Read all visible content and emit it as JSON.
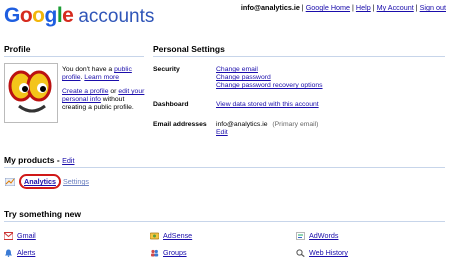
{
  "header": {
    "logo_letters": [
      "G",
      "o",
      "o",
      "g",
      "l",
      "e"
    ],
    "logo_colors": [
      "#1e5ee0",
      "#d62b1e",
      "#f2b60a",
      "#1e5ee0",
      "#1b9d33",
      "#d62b1e"
    ],
    "product_name": "accounts",
    "user_email": "info@analytics.ie",
    "links": [
      "Google Home",
      "Help",
      "My Account",
      "Sign out"
    ]
  },
  "profile": {
    "title": "Profile",
    "text1": "You don't have a ",
    "link_public_profile": "public profile",
    "text1b": ". ",
    "link_learn_more": "Learn more",
    "link_create_profile": "Create a profile",
    "text2": " or ",
    "link_edit_personal": "edit your personal info",
    "text3": " without creating a public profile."
  },
  "personal_settings": {
    "title": "Personal Settings",
    "security_label": "Security",
    "security_links": [
      "Change email",
      "Change password",
      "Change password recovery options"
    ],
    "dashboard_label": "Dashboard",
    "dashboard_link": "View data stored with this account",
    "email_label": "Email addresses",
    "email_value": "info@analytics.ie",
    "email_note": "(Primary email)",
    "email_edit": "Edit"
  },
  "products": {
    "title": "My products",
    "sep": " - ",
    "edit_link": "Edit",
    "items": [
      {
        "name": "Analytics",
        "settings": "Settings"
      }
    ]
  },
  "try_new": {
    "title": "Try something new",
    "items": [
      {
        "label": "Gmail",
        "icon": "gmail-icon"
      },
      {
        "label": "AdSense",
        "icon": "adsense-icon"
      },
      {
        "label": "AdWords",
        "icon": "adwords-icon"
      },
      {
        "label": "Alerts",
        "icon": "alerts-icon"
      },
      {
        "label": "Groups",
        "icon": "groups-icon"
      },
      {
        "label": "Web History",
        "icon": "web-history-icon"
      }
    ]
  }
}
